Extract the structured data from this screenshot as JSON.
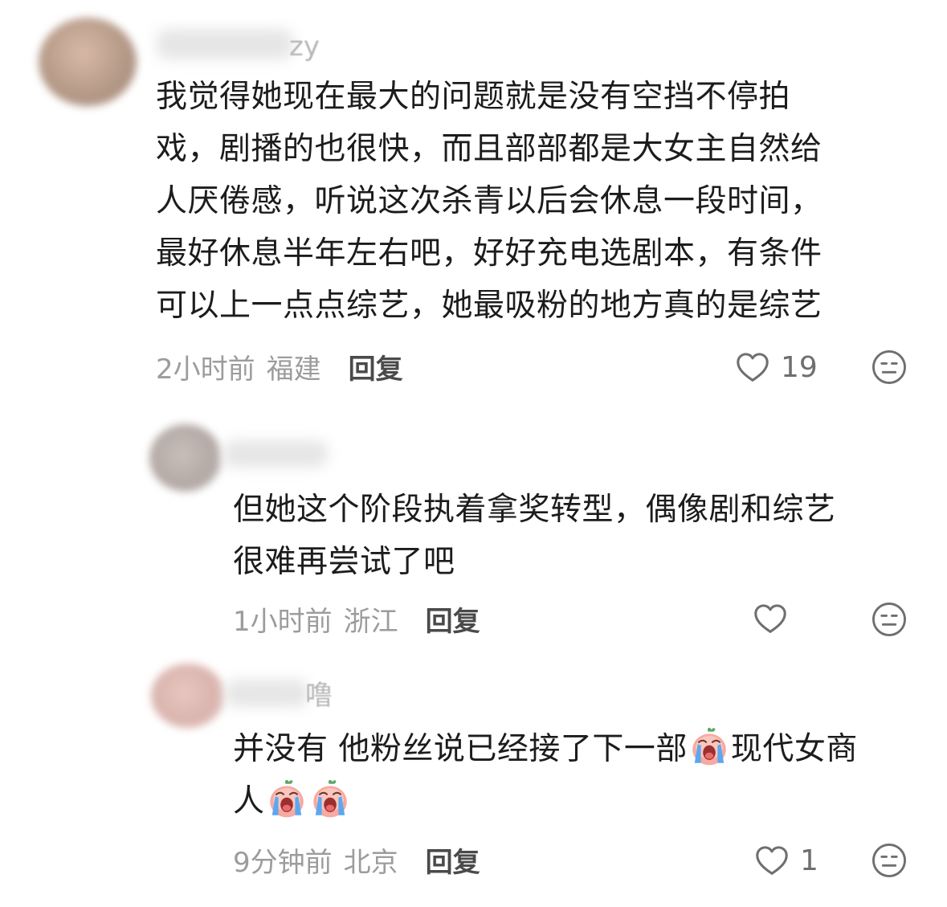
{
  "comments": [
    {
      "name_fragment": "zy",
      "text": "我觉得她现在最大的问题就是没有空挡不停拍戏，剧播的也很快，而且部部都是大女主自然给人厌倦感，听说这次杀青以后会休息一段时间，最好休息半年左右吧，好好充电选剧本，有条件可以上一点点综艺，她最吸粉的地方真的是综艺",
      "lines": [
        "我觉得她现在最大的问题就是没有空挡不停拍",
        "戏，剧播的也很快，而且部部都是大女主自然给",
        "人厌倦感，听说这次杀青以后会休息一段时间，",
        "最好休息半年左右吧，好好充电选剧本，有条件",
        "可以上一点点综艺，她最吸粉的地方真的是综艺"
      ],
      "time": "2小时前",
      "location": "福建",
      "reply_label": "回复",
      "likes": "19"
    },
    {
      "name_fragment": "",
      "lines": [
        "但她这个阶段执着拿奖转型，偶像剧和综艺",
        "很难再尝试了吧"
      ],
      "time": "1小时前",
      "location": "浙江",
      "reply_label": "回复",
      "likes": ""
    },
    {
      "name_fragment": "噜",
      "line1_a": "并没有 他粉丝说已经接了下一部",
      "line1_b": "现代女商",
      "line2": "人",
      "emoji_icon": "crying-face-emoji-icon",
      "time": "9分钟前",
      "location": "北京",
      "reply_label": "回复",
      "likes": "1"
    }
  ],
  "icons": {
    "like": "heart-outline-icon",
    "dislike": "meh-face-icon"
  },
  "colors": {
    "text": "#1c1c1c",
    "meta": "#9c9c9c",
    "reply": "#4a4a4a",
    "icon": "#6f6f6f"
  }
}
